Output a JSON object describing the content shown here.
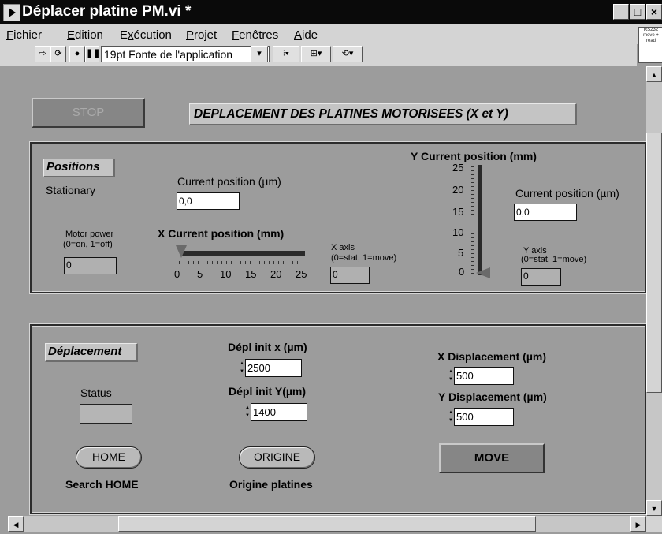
{
  "window": {
    "title": "Déplacer platine PM.vi *",
    "minimize": "_",
    "maximize": "□",
    "close": "×"
  },
  "menu": [
    "Fichier",
    "Edition",
    "Exécution",
    "Projet",
    "Fenêtres",
    "Aide"
  ],
  "menu_underline": [
    "F",
    "E",
    "x",
    "P",
    "F",
    "A"
  ],
  "toolbar": {
    "font": "19pt Fonte de l'application",
    "run_icon": "run-arrow-icon",
    "run_continuous_icon": "run-continuous-icon",
    "abort_icon": "abort-icon",
    "pause_icon": "pause-icon"
  },
  "vi_icon_text": "RS232 move + read",
  "panel": {
    "stop_label": "STOP",
    "title": "DEPLACEMENT DES PLATINES MOTORISEES (X et Y)"
  },
  "positions": {
    "group_label": "Positions",
    "status_text": "Stationary",
    "x_current_label": "Current position (µm)",
    "x_current_value": "0,0",
    "motor_power_label": "Motor power",
    "motor_power_sub": "(0=on, 1=off)",
    "motor_power_value": "0",
    "x_slider_label": "X Current position (mm)",
    "x_slider_ticks": [
      "0",
      "5",
      "10",
      "15",
      "20",
      "25"
    ],
    "x_slider_value": 0,
    "x_slider_max": 25,
    "x_axis_label": "X axis",
    "x_axis_sub": "(0=stat, 1=move)",
    "x_axis_value": "0",
    "y_slider_label": "Y Current position (mm)",
    "y_slider_ticks": [
      "25",
      "20",
      "15",
      "10",
      "5",
      "0"
    ],
    "y_slider_value": 0,
    "y_slider_max": 25,
    "y_current_label": "Current position (µm)",
    "y_current_value": "0,0",
    "y_axis_label": "Y axis",
    "y_axis_sub": "(0=stat, 1=move)",
    "y_axis_value": "0"
  },
  "deplacement": {
    "group_label": "Déplacement",
    "status_label": "Status",
    "depl_init_x_label": "Dépl init x (µm)",
    "depl_init_x_value": "2500",
    "depl_init_y_label": "Dépl init Y(µm)",
    "depl_init_y_value": "1400",
    "x_disp_label": "X Displacement (µm)",
    "x_disp_value": "500",
    "y_disp_label": "Y Displacement (µm)",
    "y_disp_value": "500",
    "home_button": "HOME",
    "home_caption": "Search HOME",
    "origine_button": "ORIGINE",
    "origine_caption": "Origine platines",
    "move_button": "MOVE"
  },
  "colors": {
    "panel_bg": "#9c9c9c",
    "title_bar": "#0a0a0a",
    "menu_bg": "#d4d4d4",
    "slider_fill": "#2a2a2a"
  }
}
